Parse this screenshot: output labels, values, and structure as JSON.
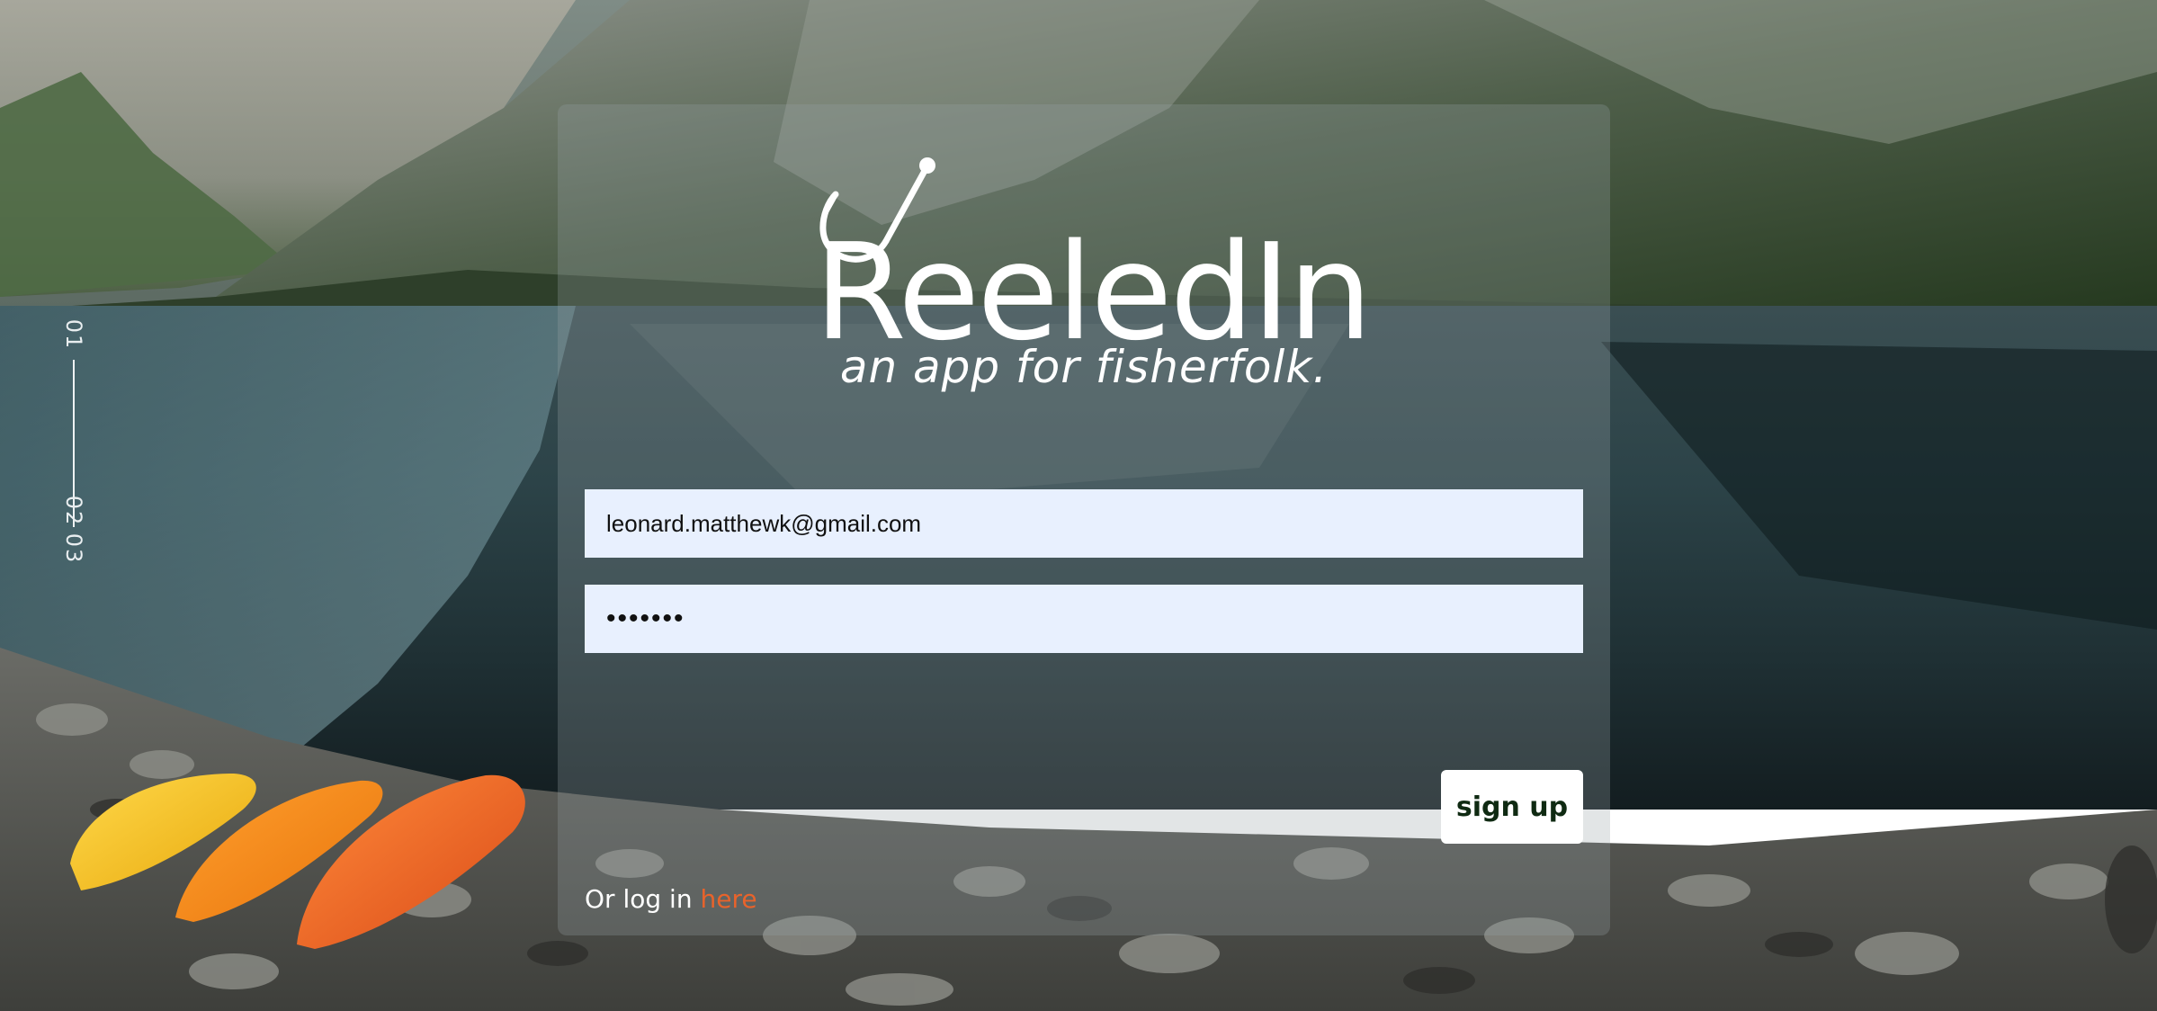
{
  "slider": {
    "current": "01",
    "next": "02",
    "last": "03"
  },
  "brand": {
    "title": "ReeledIn",
    "tagline": "an app for fisherfolk.",
    "logo_icon": "fishing-hook-icon"
  },
  "form": {
    "email_value": "leonard.matthewk@gmail.com",
    "password_value": "•••••••",
    "signup_label": "sign up",
    "login_prefix": "Or log in ",
    "login_link": "here"
  },
  "colors": {
    "card_overlay": "#96a0a5",
    "field_bg": "#e8f0fe",
    "button_bg": "#ffffff",
    "button_text": "#0f2a12",
    "link": "#e8632b",
    "text": "#ffffff"
  }
}
